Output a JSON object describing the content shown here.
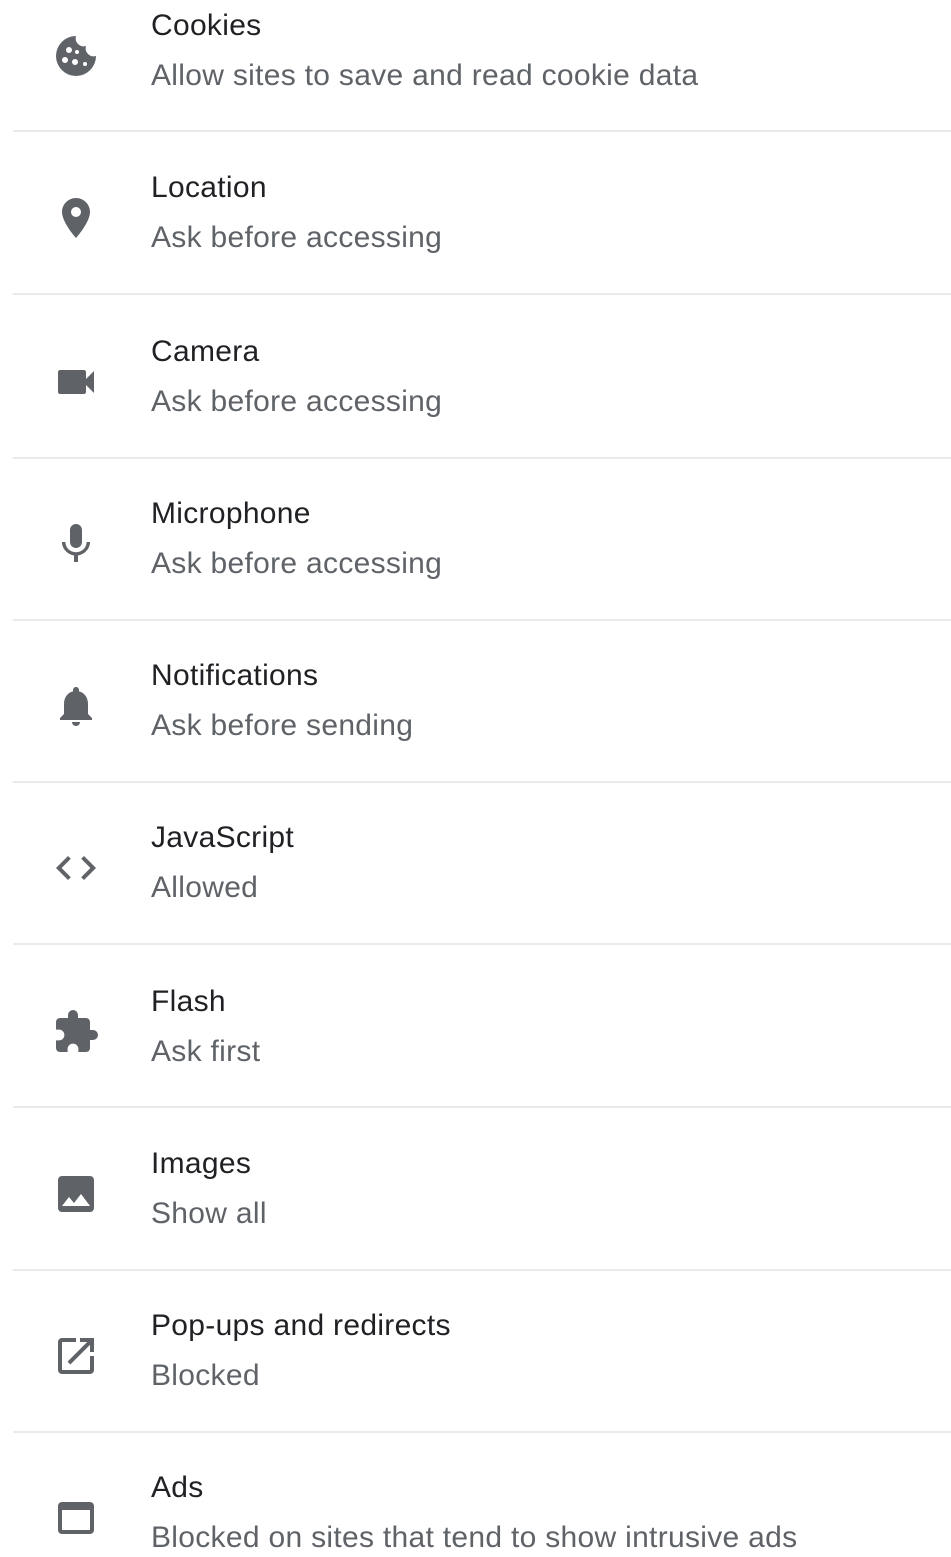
{
  "settings": {
    "items": [
      {
        "icon": "cookie-icon",
        "title": "Cookies",
        "subtitle": "Allow sites to save and read cookie data"
      },
      {
        "icon": "location-pin-icon",
        "title": "Location",
        "subtitle": "Ask before accessing"
      },
      {
        "icon": "camera-icon",
        "title": "Camera",
        "subtitle": "Ask before accessing"
      },
      {
        "icon": "microphone-icon",
        "title": "Microphone",
        "subtitle": "Ask before accessing"
      },
      {
        "icon": "bell-icon",
        "title": "Notifications",
        "subtitle": "Ask before sending"
      },
      {
        "icon": "code-icon",
        "title": "JavaScript",
        "subtitle": "Allowed"
      },
      {
        "icon": "puzzle-piece-icon",
        "title": "Flash",
        "subtitle": "Ask first"
      },
      {
        "icon": "image-icon",
        "title": "Images",
        "subtitle": "Show all"
      },
      {
        "icon": "open-in-new-icon",
        "title": "Pop-ups and redirects",
        "subtitle": "Blocked"
      },
      {
        "icon": "window-icon",
        "title": "Ads",
        "subtitle": "Blocked on sites that tend to show intrusive ads"
      }
    ]
  },
  "colors": {
    "title": "#202124",
    "subtitle": "#5f6368",
    "icon": "#5f6368",
    "divider": "#e8eaed"
  }
}
